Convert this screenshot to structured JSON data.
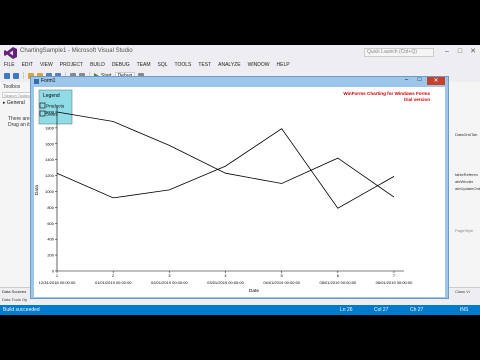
{
  "window": {
    "title": "ChartingSample1 - Microsoft Visual Studio",
    "quick_launch_placeholder": "Quick Launch (Ctrl+Q)"
  },
  "menu": [
    "FILE",
    "EDIT",
    "VIEW",
    "PROJECT",
    "BUILD",
    "DEBUG",
    "TEAM",
    "SQL",
    "TOOLS",
    "TEST",
    "ANALYZE",
    "WINDOW",
    "HELP"
  ],
  "toolbar": {
    "start_label": "Start",
    "config_label": "Debug"
  },
  "toolbox": {
    "title": "Toolbox",
    "search_placeholder": "Search Toolbox",
    "group_label": "General",
    "note_line1": "There are",
    "note_line2": "Drag an it"
  },
  "right_panel": {
    "labels": [
      "DataGridTab",
      "tableReferen",
      "ateWinder",
      "ateUpdateOrd",
      "PageStyle"
    ]
  },
  "bottom": {
    "data_sources": "Data Sources",
    "data_tools_tab": "Data Tools Op",
    "class_tab": "Class Vi"
  },
  "status": {
    "text": "Build succeeded",
    "line": "Ln 26",
    "col": "Col 27",
    "ch": "Ch 27",
    "mode": "INS"
  },
  "form": {
    "title": "Form1"
  },
  "icons": {
    "logo": "visual-studio-logo-icon",
    "form_icon": "form-icon",
    "play": "play-icon",
    "close": "close-icon",
    "minimize": "minimize-icon",
    "maximize": "maximize-icon"
  },
  "colors": {
    "status_bar": "#007acc",
    "form_border": "#9cc7ea",
    "legend_bg": "#8fdbe6",
    "watermark": "#cc0000",
    "close_button": "#c7402c"
  },
  "chart_data": {
    "type": "line",
    "watermark_line1": "WinForms Charting for Windows Forms",
    "watermark_line2": "trial version",
    "legend_title": "Legend",
    "legend_position": "top-left",
    "xlabel": "Date",
    "ylabel": "Data",
    "x_ticks_top": [
      "1",
      "2",
      "3",
      "4",
      "5",
      "6",
      "7"
    ],
    "x_ticks_dates": [
      "12/31/2018 00:00:00",
      "01/01/2019 00:00:00",
      "02/01/2019 00:00:00",
      "03/01/2019 00:00:00",
      "04/01/2019 00:00:00",
      "05/01/2019 00:00:00",
      "06/01/2019 00:00:00"
    ],
    "y_ticks": [
      "0",
      "200",
      "400",
      "600",
      "800",
      "1000",
      "1200",
      "1400",
      "1600",
      "1800",
      "2000"
    ],
    "ylim": [
      0,
      2000
    ],
    "grid": false,
    "series": [
      {
        "name": "Products",
        "values": [
          2000,
          1880,
          1580,
          1230,
          1100,
          1420,
          930
        ],
        "color": "#000000"
      },
      {
        "name": "Sales",
        "values": [
          1230,
          920,
          1020,
          1320,
          1790,
          790,
          1190
        ],
        "color": "#000000"
      }
    ]
  }
}
